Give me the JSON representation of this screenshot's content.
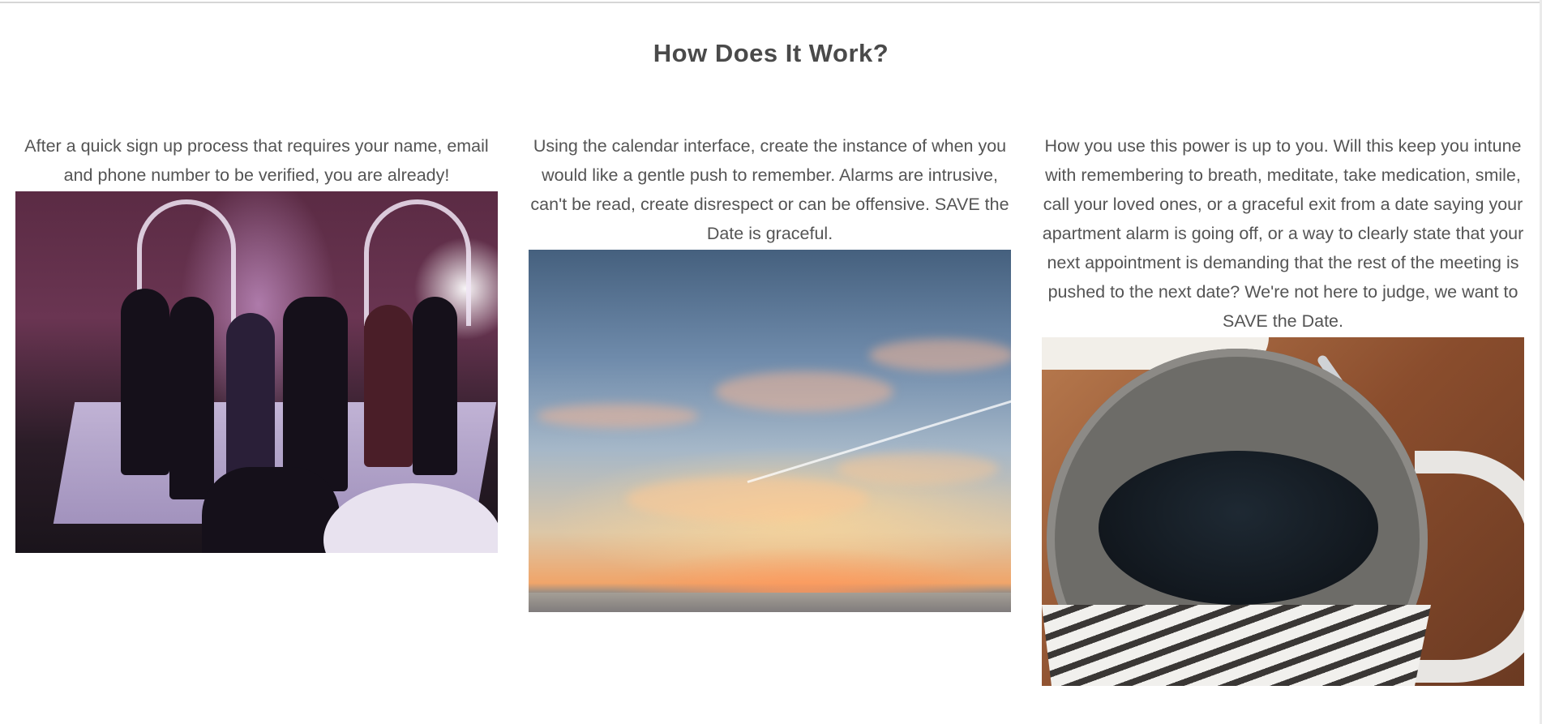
{
  "section": {
    "title": "How Does It Work?"
  },
  "columns": [
    {
      "text": "After a quick sign up process that requires your name, email and phone number to be verified, you are already!",
      "image": "ballroom-dance-photo"
    },
    {
      "text": "Using the calendar interface, create the instance of when you would like a gentle push to remember. Alarms are intrusive, can't be read, create disrespect or can be offensive. SAVE the Date is graceful.",
      "image": "sunset-sky-photo"
    },
    {
      "text": "How you use this power is up to you. Will this keep you intune with remembering to breath, meditate, take medication, smile, call your loved ones, or a graceful exit from a date saying your apartment alarm is going off, or a way to clearly state that your next appointment is demanding that the rest of the meeting is pushed to the next date? We're not here to judge, we want to SAVE the Date.",
      "image": "coffee-mug-photo"
    }
  ]
}
